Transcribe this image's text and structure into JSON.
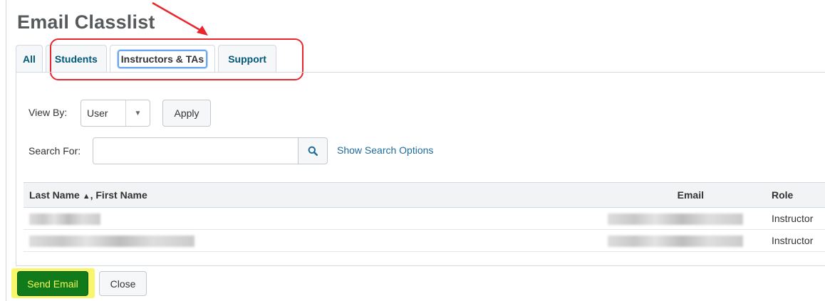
{
  "page": {
    "title": "Email Classlist"
  },
  "tabs": [
    {
      "label": "All"
    },
    {
      "label": "Students"
    },
    {
      "label": "Instructors & TAs"
    },
    {
      "label": "Support"
    }
  ],
  "filters": {
    "view_by_label": "View By:",
    "view_by_value": "User",
    "apply_label": "Apply",
    "search_label": "Search For:",
    "search_value": "",
    "search_placeholder": "",
    "show_search_options": "Show Search Options"
  },
  "table": {
    "headers": {
      "name": "Last Name",
      "name_suffix": ", First Name",
      "email": "Email",
      "role": "Role"
    },
    "rows": [
      {
        "role": "Instructor"
      },
      {
        "role": "Instructor"
      }
    ]
  },
  "footer": {
    "send_label": "Send Email",
    "close_label": "Close"
  },
  "colors": {
    "annotation_red": "#e8262e",
    "highlight_yellow": "#f8f66a",
    "send_green": "#117a1b",
    "link_blue": "#1d6b9a"
  }
}
